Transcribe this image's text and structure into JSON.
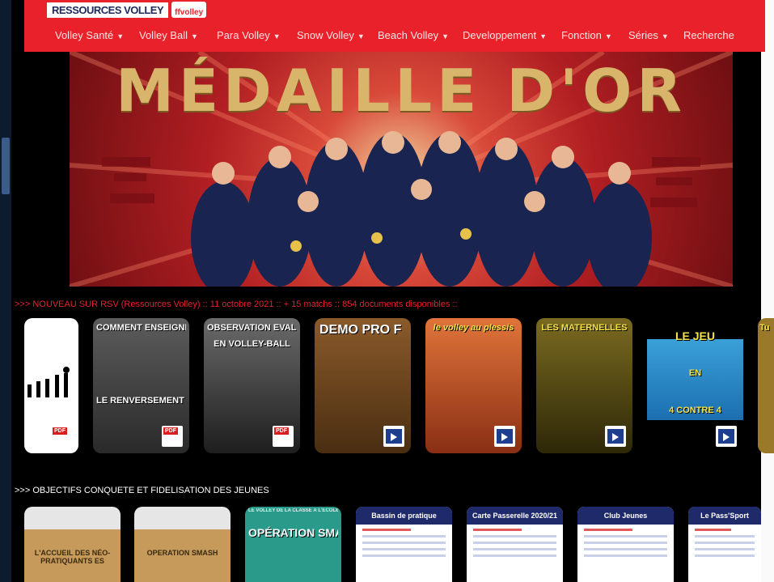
{
  "logo": {
    "text": "RESSOURCES VOLLEY",
    "ffv": "ffvolley"
  },
  "nav": [
    {
      "label": "Volley Santé",
      "caret": "▼"
    },
    {
      "label": "Volley Ball",
      "caret": "▼"
    },
    {
      "label": "Para Volley",
      "caret": "▼"
    },
    {
      "label": "Snow Volley",
      "caret": "▼"
    },
    {
      "label": "Beach Volley",
      "caret": "▼"
    },
    {
      "label": "Developpement",
      "caret": "▼"
    },
    {
      "label": "Fonction",
      "caret": "▼"
    },
    {
      "label": "Séries",
      "caret": "▼"
    },
    {
      "label": "Recherche",
      "caret": ""
    }
  ],
  "hero": {
    "title": "MÉDAILLE D'OR"
  },
  "news_ticker": ">>> NOUVEAU SUR RSV (Ressources Volley) :: 11 octobre 2021 :: + 15 matchs :: 854 documents disponibles ::",
  "cards_row1": [
    {
      "title": "",
      "badge": "pdf",
      "badge_text": "PDF"
    },
    {
      "title": "COMMENT ENSEIGNER",
      "subtitle": "LE RENVERSEMENT DE JEU",
      "badge": "pdf",
      "badge_text": "PDF"
    },
    {
      "title": "OBSERVATION EVALUATION",
      "subtitle": "EN VOLLEY-BALL",
      "badge": "pdf",
      "badge_text": "PDF"
    },
    {
      "title": "DEMO PRO F",
      "badge": "video"
    },
    {
      "title": "le volley au plessis",
      "badge": "video"
    },
    {
      "title": "LES MATERNELLES",
      "badge": "video"
    },
    {
      "title": "LE JEU",
      "subtitle": "EN",
      "subtitle2": "4 CONTRE 4",
      "badge": "video"
    },
    {
      "title": "Tu",
      "badge": ""
    }
  ],
  "section2_label": ">>> OBJECTIFS CONQUETE ET FIDELISATION DES JEUNES",
  "cards_row2": [
    {
      "title": "L'ACCUEIL DES NÉO-PRATIQUANTS ES"
    },
    {
      "title": "OPERATION SMASH"
    },
    {
      "title": "OPÉRATION SMASHY",
      "top": "LE VOLLEY DE LA CLASSE À L'ÉCOLE"
    },
    {
      "title": "Bassin de pratique"
    },
    {
      "title": "Carte Passerelle 2020/21"
    },
    {
      "title": "Club Jeunes"
    },
    {
      "title": "Le Pass'Sport"
    }
  ],
  "colors": {
    "brand_red": "#e8212a",
    "gold": "#d9b56c",
    "navy": "#1f2a6b"
  }
}
